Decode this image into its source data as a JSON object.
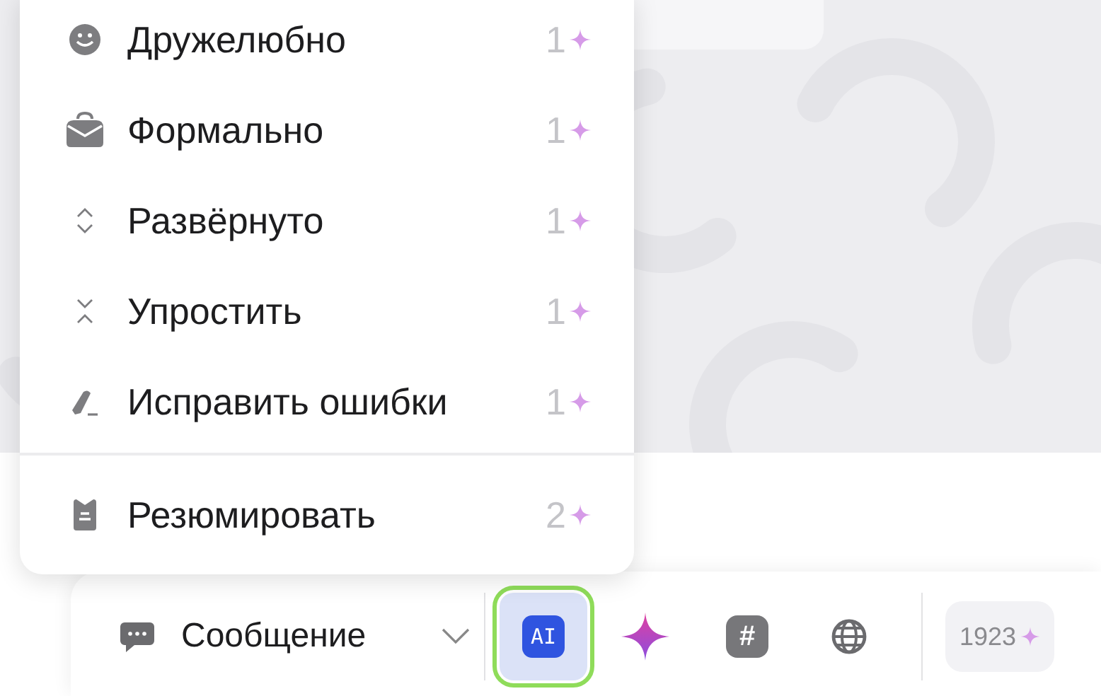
{
  "menu": {
    "sections": [
      {
        "items": [
          {
            "kind": "smile",
            "label": "Дружелюбно",
            "cost": "1"
          },
          {
            "kind": "bag",
            "label": "Формально",
            "cost": "1"
          },
          {
            "kind": "expand",
            "label": "Развёрнуто",
            "cost": "1"
          },
          {
            "kind": "collapse",
            "label": "Упростить",
            "cost": "1"
          },
          {
            "kind": "pen",
            "label": "Исправить ошибки",
            "cost": "1"
          }
        ]
      },
      {
        "items": [
          {
            "kind": "clipboard",
            "label": "Резюмировать",
            "cost": "2"
          }
        ]
      }
    ]
  },
  "composer": {
    "mode_label": "Сообщение",
    "tools": [
      {
        "kind": "ai",
        "label": "AI",
        "selected": true
      },
      {
        "kind": "sparkle",
        "selected": false
      },
      {
        "kind": "hash",
        "label": "#",
        "selected": false
      },
      {
        "kind": "globe",
        "selected": false
      }
    ],
    "credits": "1923"
  }
}
